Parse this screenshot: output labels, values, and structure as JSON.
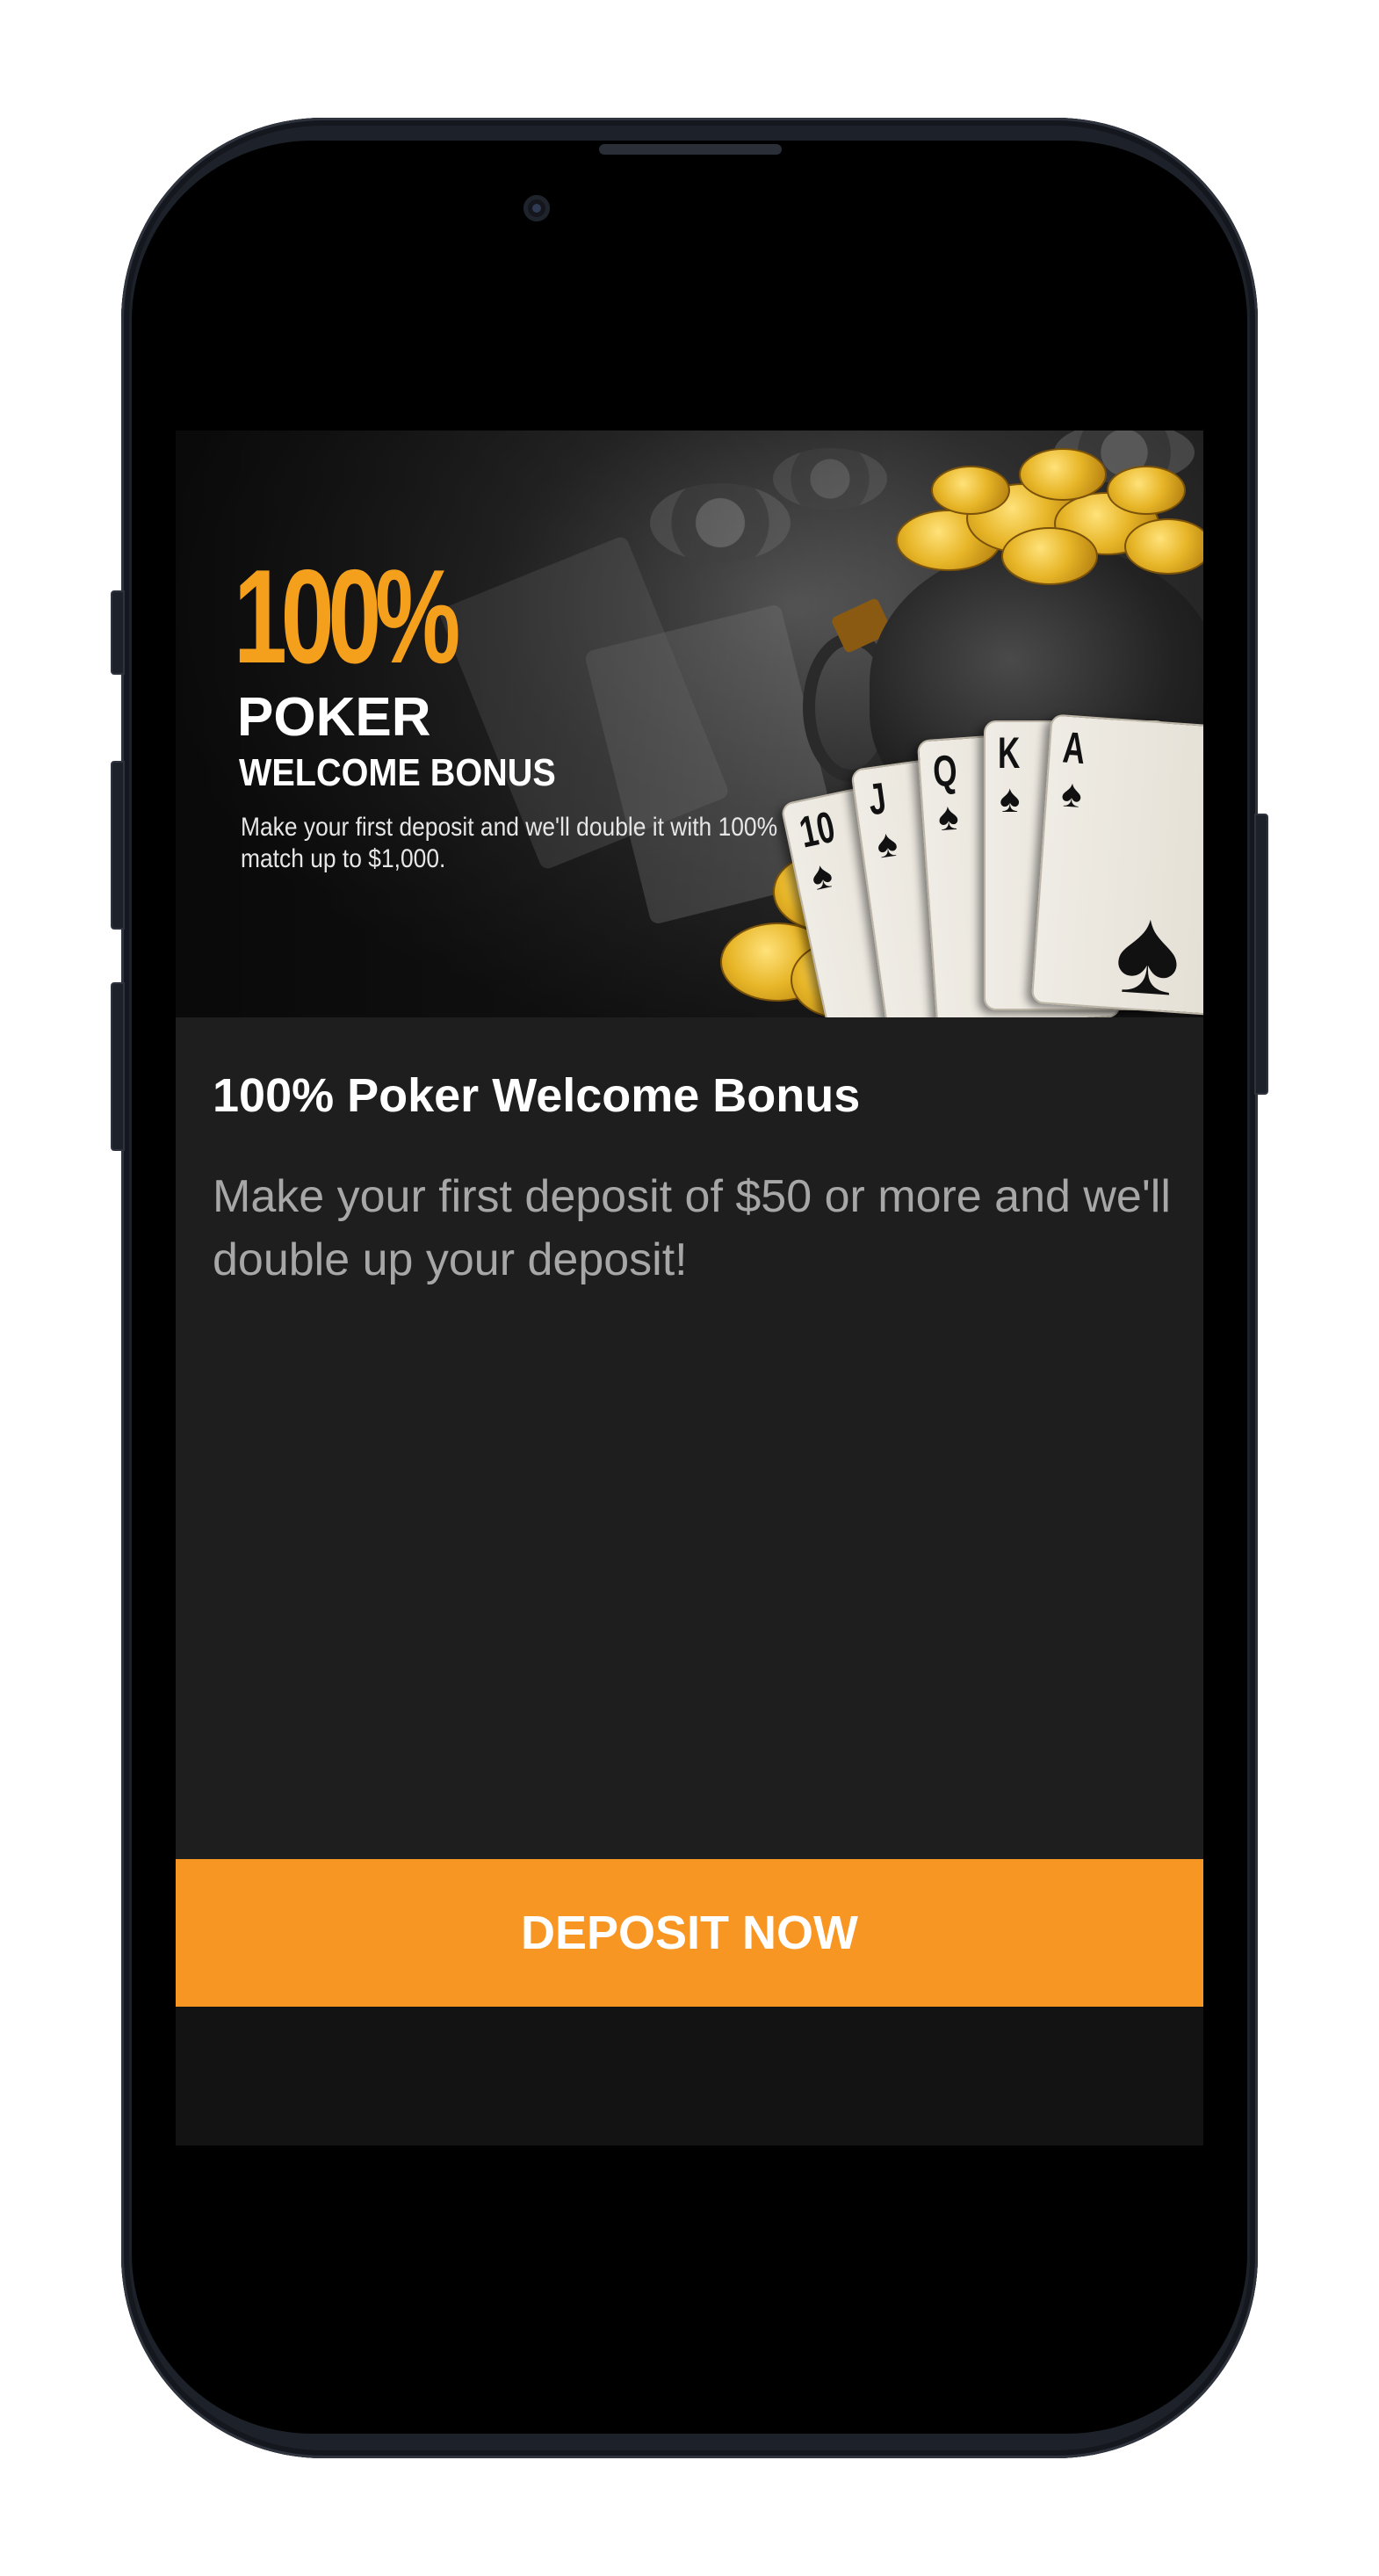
{
  "banner": {
    "percent": "100%",
    "poker": "POKER",
    "welcome": "WELCOME BONUS",
    "description": "Make your first deposit and we'll double it with 100% match up to $1,000.",
    "cards": [
      {
        "rank": "10",
        "suit": "♠"
      },
      {
        "rank": "J",
        "suit": "♠"
      },
      {
        "rank": "Q",
        "suit": "♠"
      },
      {
        "rank": "K",
        "suit": "♠"
      },
      {
        "rank": "A",
        "suit": "♠"
      }
    ]
  },
  "promo": {
    "title": "100% Poker Welcome Bonus",
    "description": "Make your first deposit of $50 or more and we'll double up your deposit!"
  },
  "cta": {
    "label": "DEPOSIT NOW"
  },
  "colors": {
    "accent": "#f79622",
    "banner_orange": "#f5a01c",
    "panel": "#1e1e1e",
    "screen": "#131313"
  }
}
